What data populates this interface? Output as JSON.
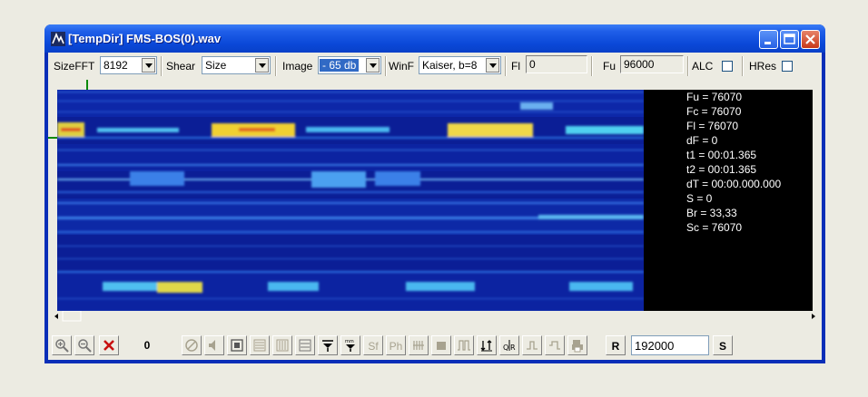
{
  "window": {
    "title": "[TempDir] FMS-BOS(0).wav"
  },
  "toolbar": {
    "sizefft_label": "SizeFFT",
    "sizefft_value": "8192",
    "shear_label": "Shear",
    "shear_value": "Size",
    "image_label": "Image",
    "image_value": "- 65 db",
    "winf_label": "WinF",
    "winf_value": "Kaiser, b=8",
    "fl_label": "Fl",
    "fl_value": "0",
    "fu_label": "Fu",
    "fu_value": "96000",
    "alc_label": "ALC",
    "hres_label": "HRes"
  },
  "info": {
    "lines": [
      "Fu = 76070",
      "Fc = 76070",
      "Fl = 76070",
      "dF = 0",
      "t1 = 00:01.365",
      "t2 = 00:01.365",
      "dT = 00:00.000.000",
      "S = 0",
      "Br = 33,33",
      "Sc = 76070"
    ]
  },
  "bottom": {
    "counter": "0",
    "sf": "Sf",
    "ph": "Ph",
    "r": "R",
    "s": "S",
    "rate_value": "192000"
  },
  "colors": {
    "title_blue": "#0a48d8",
    "spectrum_bg": "#0a1a8a",
    "info_bg": "#000000"
  }
}
